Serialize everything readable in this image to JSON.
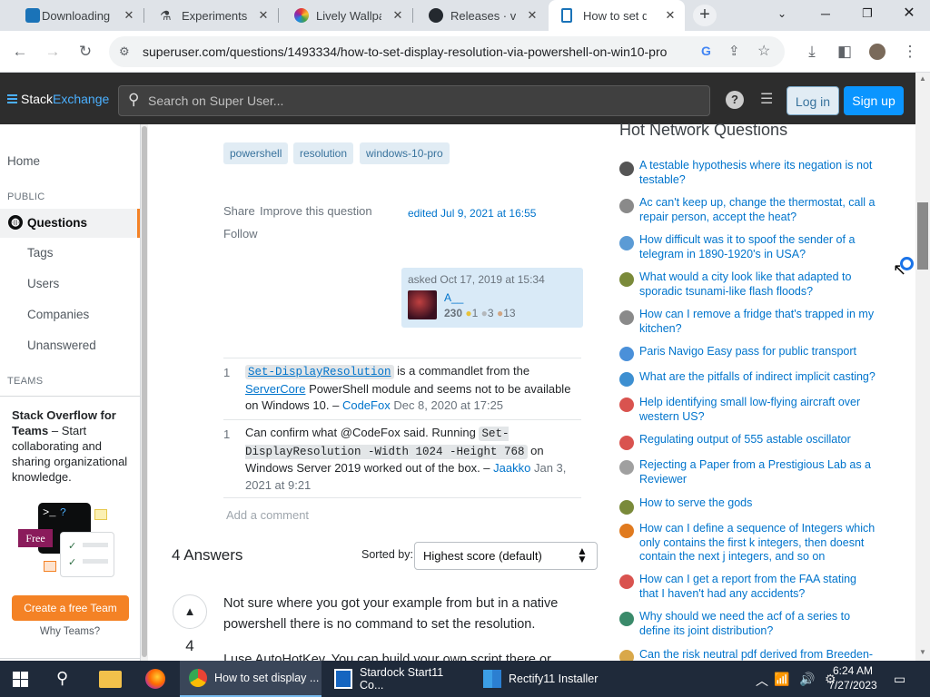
{
  "browser": {
    "tabs": [
      {
        "title": "Downloading",
        "active": false
      },
      {
        "title": "Experiments",
        "active": false
      },
      {
        "title": "Lively Wallpaper",
        "active": false
      },
      {
        "title": "Releases · valinet",
        "active": false
      },
      {
        "title": "How to set display",
        "active": true
      }
    ],
    "url": "superuser.com/questions/1493334/how-to-set-display-resolution-via-powershell-on-win10-pro"
  },
  "topbar": {
    "logo_stack": "Stack",
    "logo_exchange": "Exchange",
    "search_placeholder": "Search on Super User...",
    "login": "Log in",
    "signup": "Sign up"
  },
  "sidebar": {
    "home": "Home",
    "public_label": "PUBLIC",
    "questions": "Questions",
    "tags": "Tags",
    "users": "Users",
    "companies": "Companies",
    "unanswered": "Unanswered",
    "teams_label": "TEAMS",
    "teams_title": "Stack Overflow for Teams",
    "teams_text": " – Start collaborating and sharing organizational knowledge.",
    "free_badge": "Free",
    "create_team": "Create a free Team",
    "why_teams": "Why Teams?"
  },
  "question": {
    "tags": [
      "powershell",
      "resolution",
      "windows-10-pro"
    ],
    "share": "Share",
    "improve": "Improve this question",
    "follow": "Follow",
    "edited": "edited Jul 9, 2021 at 16:55",
    "asked": "asked Oct 17, 2019 at 15:34",
    "user_name": "A__",
    "user_rep": "230",
    "gold": "1",
    "silver": "3",
    "bronze": "13"
  },
  "comments": [
    {
      "score": "1",
      "code": "Set-DisplayResolution",
      "text1": " is a commandlet from the ",
      "link": "ServerCore",
      "text2": " PowerShell module and seems not to be available on Windows 10. – ",
      "user": "CodeFox",
      "date": "Dec 8, 2020 at 17:25"
    },
    {
      "score": "1",
      "text1": "Can confirm what @CodeFox said. Running ",
      "code": "Set-DisplayResolution -Width 1024 -Height 768",
      "text2": " on Windows Server 2019 worked out of the box. – ",
      "user": "Jaakko",
      "date": "Jan 3, 2021 at 9:21"
    }
  ],
  "add_comment": "Add a comment",
  "answers": {
    "count_label": "4 Answers",
    "sorted_by": "Sorted by:",
    "sort_value": "Highest score (default)",
    "first_score": "4",
    "first_line1": "Not sure where you got your example from but in a native",
    "first_line2": "powershell there is no command to set the resolution.",
    "first_line3": "I use AutoHotKey. You can build your own script there or"
  },
  "hot_network": {
    "title": "Hot Network Questions",
    "items": [
      {
        "text": "A testable hypothesis where its negation is not testable?",
        "icon": "philosophy-icon",
        "color": "#555555"
      },
      {
        "text": "Ac can't keep up, change the thermostat, call a repair person, accept the heat?",
        "icon": "diy-icon",
        "color": "#8a8a8a"
      },
      {
        "text": "How difficult was it to spoof the sender of a telegram in 1890-1920's in USA?",
        "icon": "history-icon",
        "color": "#5b9bd5"
      },
      {
        "text": "What would a city look like that adapted to sporadic tsunami-like flash floods?",
        "icon": "worldbuilding-icon",
        "color": "#7a8a3a"
      },
      {
        "text": "How can I remove a fridge that's trapped in my kitchen?",
        "icon": "diy-icon",
        "color": "#8a8a8a"
      },
      {
        "text": "Paris Navigo Easy pass for public transport",
        "icon": "travel-icon",
        "color": "#4a90d9"
      },
      {
        "text": "What are the pitfalls of indirect implicit casting?",
        "icon": "softwareengineering-icon",
        "color": "#3d8fd1"
      },
      {
        "text": "Help identifying small low-flying aircraft over western US?",
        "icon": "aviation-icon",
        "color": "#d9534f"
      },
      {
        "text": "Regulating output of 555 astable oscillator",
        "icon": "electronics-icon",
        "color": "#d9534f"
      },
      {
        "text": "Rejecting a Paper from a Prestigious Lab as a Reviewer",
        "icon": "academia-icon",
        "color": "#a0a0a0"
      },
      {
        "text": "How to serve the gods",
        "icon": "worldbuilding-icon",
        "color": "#7a8a3a"
      },
      {
        "text": "How can I define a sequence of Integers which only contains the first k integers, then doesnt contain the next j integers, and so on",
        "icon": "mathematica-icon",
        "color": "#e07a1f"
      },
      {
        "text": "How can I get a report from the FAA stating that I haven't had any accidents?",
        "icon": "aviation-icon",
        "color": "#d9534f"
      },
      {
        "text": "Why should we need the acf of a series to define its joint distribution?",
        "icon": "stats-icon",
        "color": "#3a8a6a"
      },
      {
        "text": "Can the risk neutral pdf derived from Breeden-",
        "icon": "quant-icon",
        "color": "#d9a84a"
      }
    ]
  },
  "taskbar": {
    "chrome_label": "How to set display ...",
    "start11_label": "Stardock Start11 Co...",
    "rectify_label": "Rectify11 Installer",
    "time": "6:24 AM",
    "date": "7/27/2023"
  }
}
